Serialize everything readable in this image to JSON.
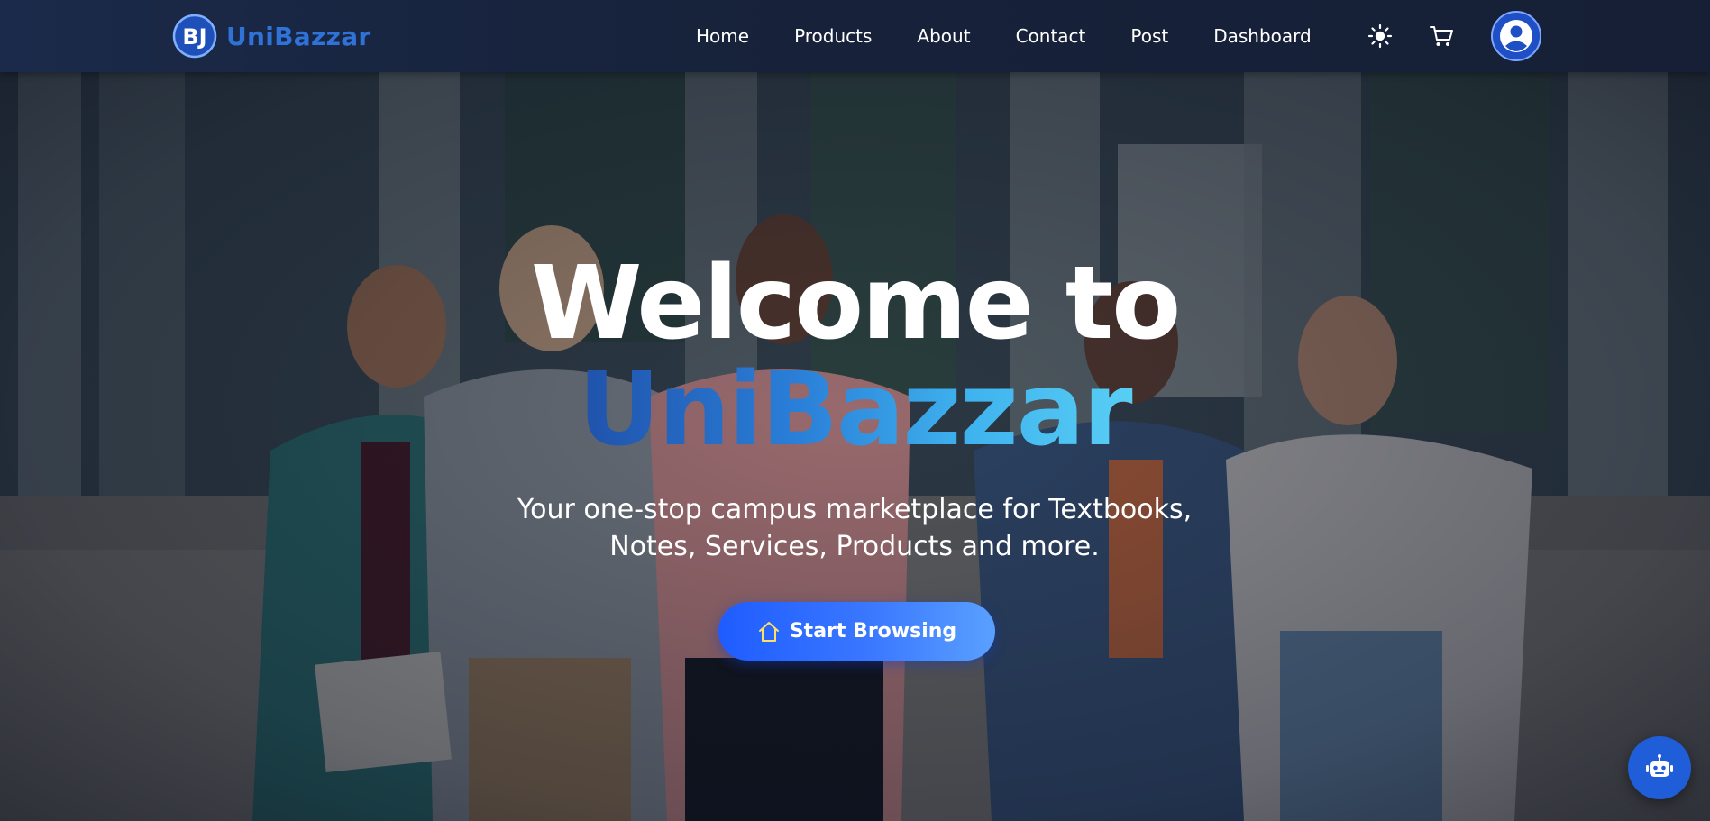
{
  "navbar": {
    "brand_name": "UniBazzar",
    "brand_logo_letter": "BJ",
    "links": [
      {
        "label": "Home"
      },
      {
        "label": "Products"
      },
      {
        "label": "About"
      },
      {
        "label": "Contact"
      },
      {
        "label": "Post"
      },
      {
        "label": "Dashboard"
      }
    ],
    "icons": {
      "theme_toggle": "sun-icon",
      "cart": "cart-icon",
      "profile": "user-avatar-icon"
    }
  },
  "hero": {
    "title_line_1": "Welcome to",
    "title_line_2": "UniBazzar",
    "subtitle": "Your one-stop campus marketplace for Textbooks, Notes, Services, Products and more.",
    "cta_label": "Start Browsing",
    "cta_icon": "home-icon"
  },
  "chatbot": {
    "icon": "robot-icon"
  },
  "colors": {
    "navbar_bg": "#17223b",
    "brand_blue": "#2f73d9",
    "title_gradient_start": "#1f4fa8",
    "title_gradient_end": "#5ad0f5",
    "cta_start": "#1f5cff",
    "cta_end": "#5aa0ff",
    "chatbot_bg": "#1f5ed8",
    "cta_icon_color": "#ffe066"
  }
}
